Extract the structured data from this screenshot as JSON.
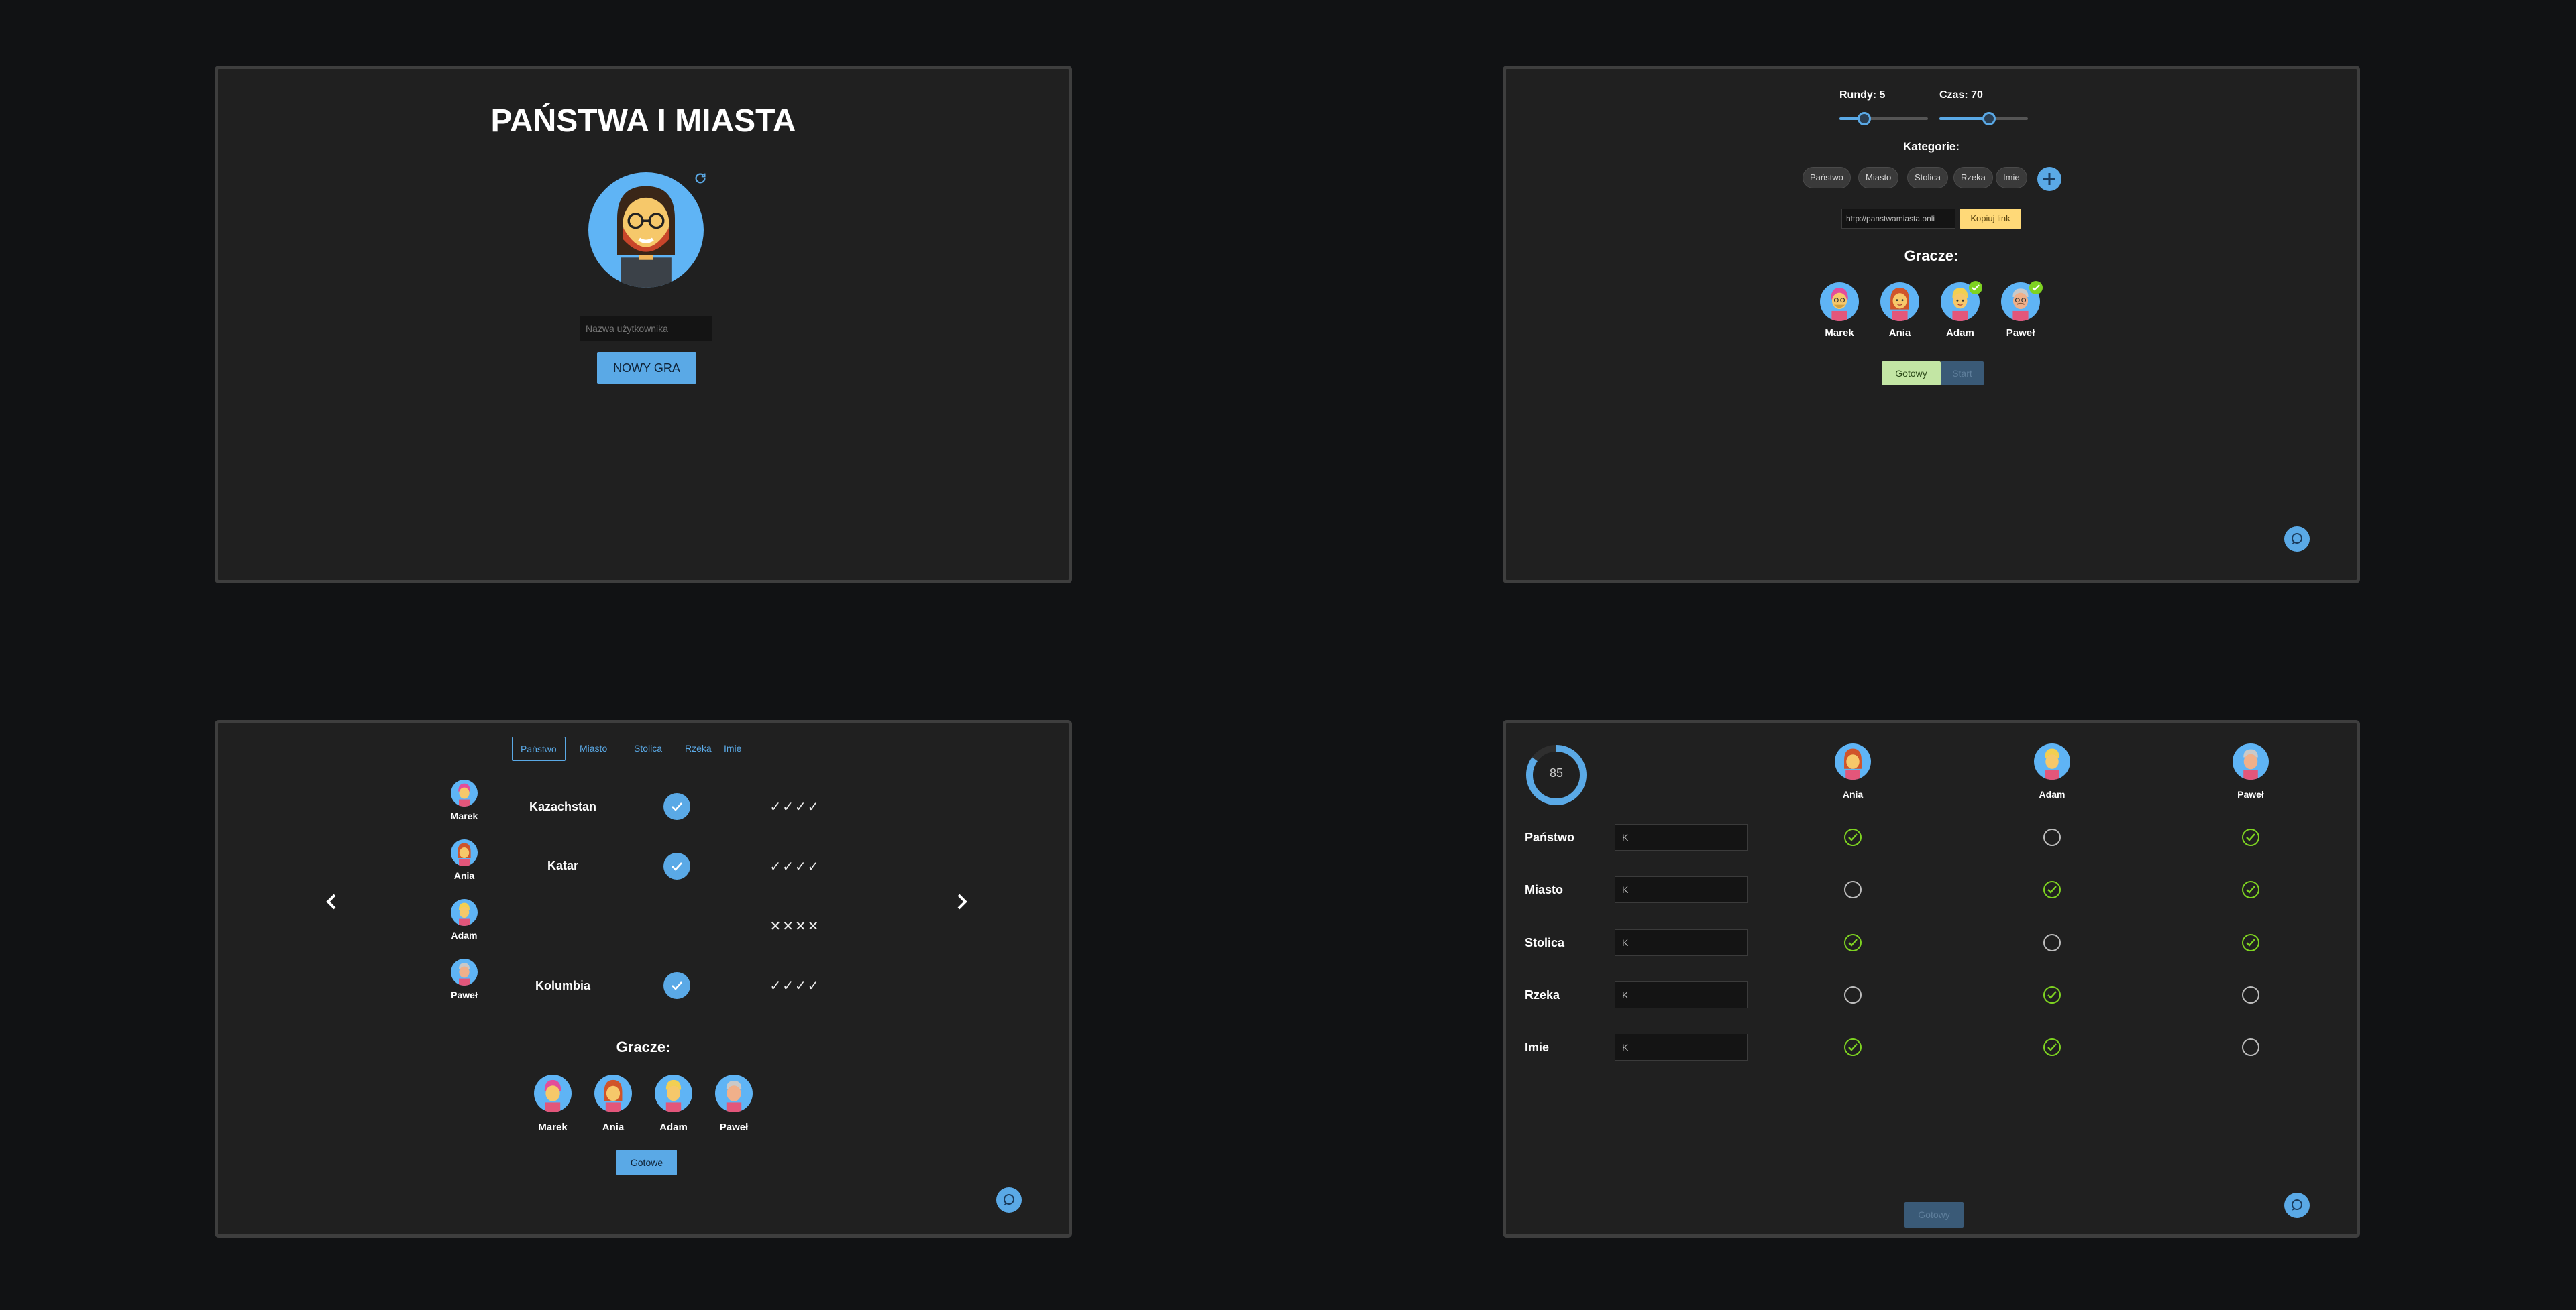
{
  "login": {
    "title": "PAŃSTWA I MIASTA",
    "username_placeholder": "Nazwa użytkownika",
    "new_game_label": "NOWY GRA"
  },
  "lobby": {
    "rounds_label": "Rundy: 5",
    "rounds_value": 5,
    "time_label": "Czas: 70",
    "time_value": 70,
    "categories_label": "Kategorie:",
    "categories": [
      "Państwo",
      "Miasto",
      "Stolica",
      "Rzeka",
      "Imie"
    ],
    "add_icon": "plus-icon",
    "link_value": "http://panstwamiasta.onli",
    "copy_label": "Kopiuj link",
    "players_label": "Gracze:",
    "players": [
      {
        "name": "Marek",
        "ready": false
      },
      {
        "name": "Ania",
        "ready": false
      },
      {
        "name": "Adam",
        "ready": true
      },
      {
        "name": "Paweł",
        "ready": true
      }
    ],
    "ready_label": "Gotowy",
    "start_label": "Start"
  },
  "voting": {
    "tabs": [
      "Państwo",
      "Miasto",
      "Stolica",
      "Rzeka",
      "Imie"
    ],
    "active_tab": "Państwo",
    "rows": [
      {
        "player": "Marek",
        "answer": "Kazachstan",
        "accepted": true,
        "votes": "✓✓✓✓"
      },
      {
        "player": "Ania",
        "answer": "Katar",
        "accepted": true,
        "votes": "✓✓✓✓"
      },
      {
        "player": "Adam",
        "answer": "",
        "accepted": false,
        "votes": "✕✕✕✕"
      },
      {
        "player": "Paweł",
        "answer": "Kolumbia",
        "accepted": true,
        "votes": "✓✓✓✓"
      }
    ],
    "players_label": "Gracze:",
    "players": [
      "Marek",
      "Ania",
      "Adam",
      "Paweł"
    ],
    "done_label": "Gotowe"
  },
  "answers": {
    "timer": "85",
    "timer_fraction": 0.85,
    "players": [
      "Ania",
      "Adam",
      "Paweł"
    ],
    "rows": [
      {
        "category": "Państwo",
        "value": "K",
        "status": [
          true,
          false,
          true
        ]
      },
      {
        "category": "Miasto",
        "value": "K",
        "status": [
          false,
          true,
          true
        ]
      },
      {
        "category": "Stolica",
        "value": "K",
        "status": [
          true,
          false,
          true
        ]
      },
      {
        "category": "Rzeka",
        "value": "K",
        "status": [
          false,
          true,
          false
        ]
      },
      {
        "category": "Imie",
        "value": "K",
        "status": [
          true,
          true,
          false
        ]
      }
    ],
    "done_label": "Gotowy"
  },
  "colors": {
    "accent": "#5aa9e6",
    "ready_green": "#c3e6a4",
    "copy_yellow": "#ffd978",
    "check_green": "#7ed321"
  }
}
